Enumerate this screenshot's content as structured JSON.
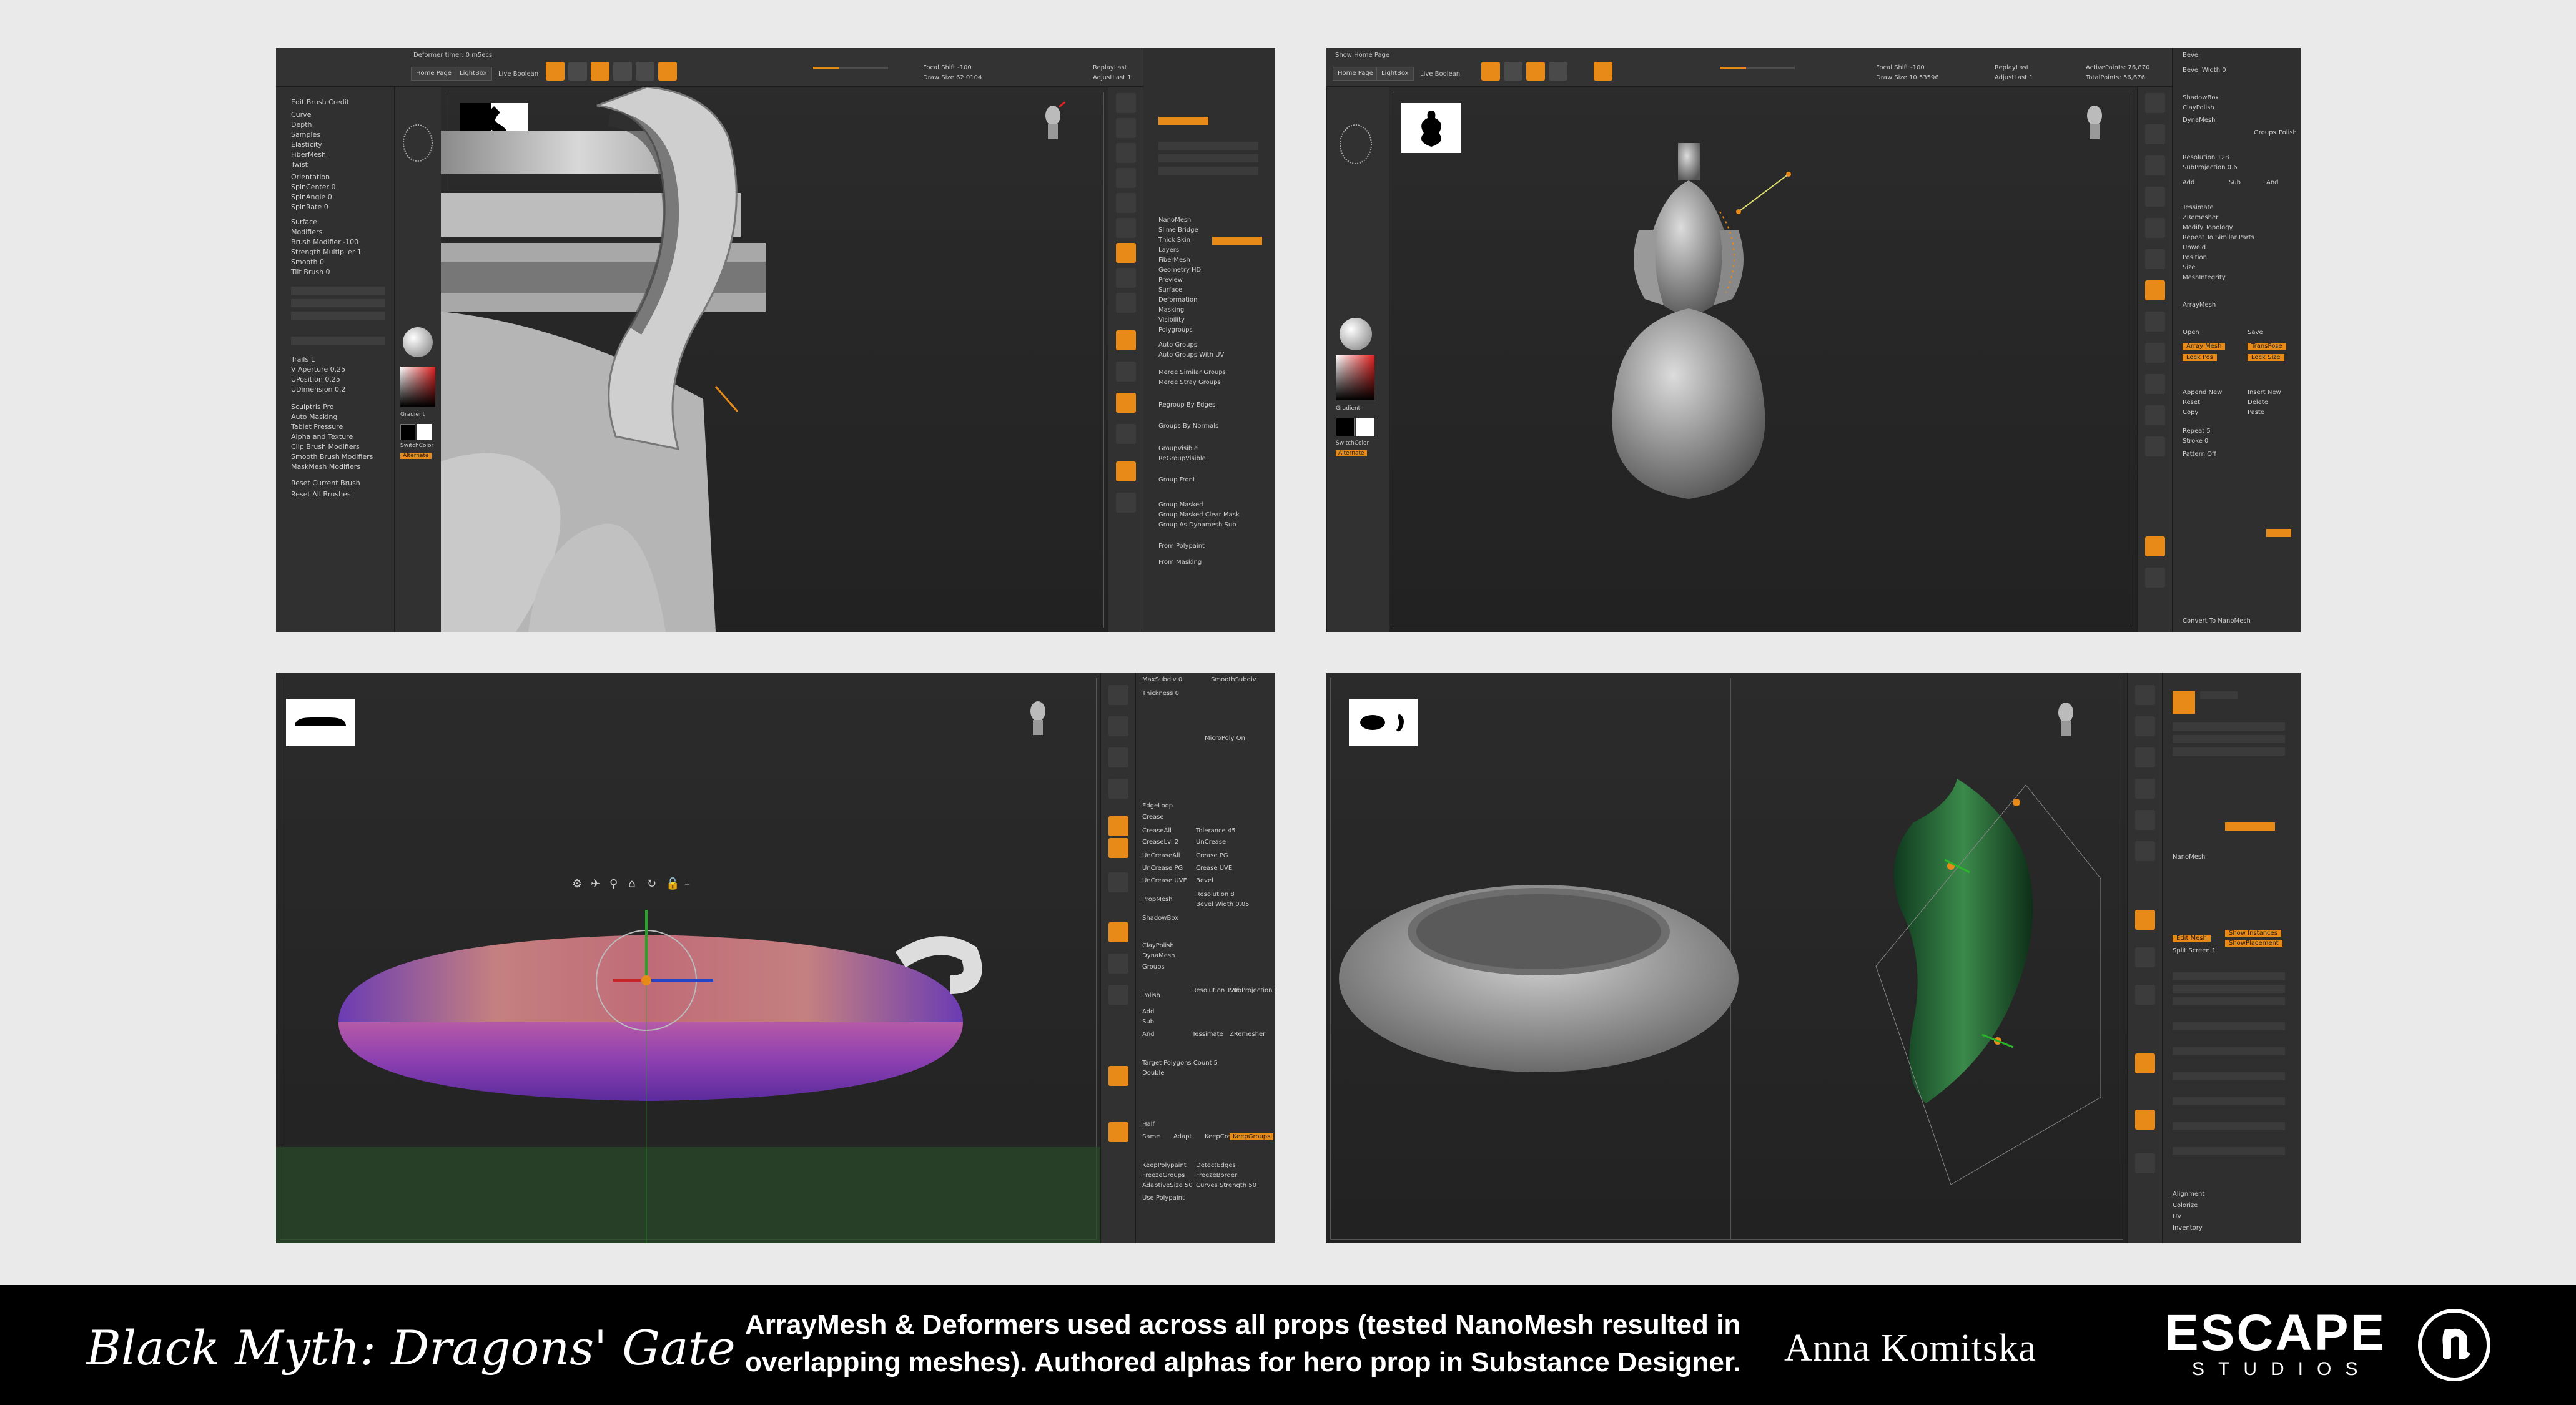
{
  "panels": [
    {
      "header": {
        "status": "Deformer timer: 0 m5ecs",
        "home_tab": "Home Page",
        "lightbox_tab": "LightBox",
        "live_boolean": "Live Boolean",
        "focal": "Focal Shift -100",
        "draw_size": "Draw Size 62.0104",
        "replay": "ReplayLast",
        "adjust": "AdjustLast 1"
      },
      "left_menu": [
        "Edit Brush Credit",
        "Curve",
        "Depth",
        "Samples",
        "Elasticity",
        "FiberMesh",
        "Twist",
        "Orientation",
        "SpinCenter 0",
        "SpinAngle 0",
        "SpinRate 0",
        "Surface",
        "Modifiers",
        "Brush Modifier -100",
        "Strength Multiplier 1",
        "Smooth 0",
        "Tilt Brush 0",
        "Trails 1",
        "V Aperture 0.25",
        "UPosition 0.25",
        "UDimension 0.2",
        "Sculptris Pro",
        "Auto Masking",
        "Tablet Pressure",
        "Alpha and Texture",
        "Clip Brush Modifiers",
        "Smooth Brush Modifiers",
        "MaskMesh Modifiers",
        "Reset Current Brush",
        "Reset All Brushes"
      ],
      "right_menu": [
        "NanoMesh",
        "Slime Bridge",
        "Thick Skin",
        "Layers",
        "FiberMesh",
        "Geometry HD",
        "Preview",
        "Surface",
        "Deformation",
        "Masking",
        "Visibility",
        "Polygroups",
        "Auto Groups",
        "Auto Groups With UV",
        "Merge Similar Groups",
        "Merge Stray Groups",
        "Regroup By Edges",
        "Groups By Normals",
        "GroupVisible",
        "ReGroupVisible",
        "Group Front",
        "Group Masked",
        "Group Masked Clear Mask",
        "Group As Dynamesh Sub",
        "From Polypaint",
        "From Masking"
      ],
      "strip_labels": [
        "Gradient",
        "SwitchColor",
        "Alternate"
      ]
    },
    {
      "header": {
        "status": "Show Home Page",
        "home_tab": "Home Page",
        "lightbox_tab": "LightBox",
        "live_boolean": "Live Boolean",
        "focal": "Focal Shift -100",
        "draw_size": "Draw Size 10.53596",
        "replay": "ReplayLast",
        "adjust": "AdjustLast 1",
        "active_points": "ActivePoints: 76,870",
        "total_points": "TotalPoints: 56,676"
      },
      "right_menu": [
        "Bevel",
        "Bevel Width 0",
        "ShadowBox",
        "ClayPolish",
        "DynaMesh",
        "Groups",
        "Polish",
        "Resolution 128",
        "SubProjection 0.6",
        "Add",
        "Sub",
        "And",
        "Tessimate",
        "ZRemesher",
        "Modify Topology",
        "Repeat To Similar Parts",
        "Unweld",
        "Position",
        "Size",
        "MeshIntegrity",
        "ArrayMesh",
        "Open",
        "Save",
        "Array Mesh",
        "TransPose",
        "Lock Pos",
        "Lock Size",
        "Append New",
        "Insert New",
        "Reset",
        "Delete",
        "Copy",
        "Paste",
        "Repeat 5",
        "Stroke 0",
        "Pattern Off",
        "Convert To NanoMesh"
      ],
      "strip_labels": [
        "Gradient",
        "SwitchColor",
        "Alternate"
      ]
    },
    {
      "header": {},
      "right_menu": [
        "MaxSubdiv 0",
        "SmoothSubdiv",
        "Thickness 0",
        "MicroPoly On",
        "EdgeLoop",
        "Crease",
        "CreaseAll",
        "Tolerance 45",
        "CreaseLvl 2",
        "UnCrease",
        "UnCreaseAll",
        "Crease PG",
        "UnCrease PG",
        "Crease UVE",
        "UnCrease UVE",
        "Bevel",
        "PropMesh",
        "Resolution 8",
        "Bevel Width 0.05",
        "ShadowBox",
        "ClayPolish",
        "DynaMesh",
        "Groups",
        "Polish",
        "Resolution 128",
        "SubProjection 0.6",
        "Add",
        "Sub",
        "And",
        "Tessimate",
        "ZRemesher",
        "Target Polygons Count 5",
        "Double",
        "Half",
        "Same",
        "Adapt",
        "KeepCreases",
        "KeepGroups",
        "KeepPolypaint",
        "DetectEdges",
        "FreezeGroups",
        "FreezeBorder",
        "AdaptiveSize 50",
        "Curves Strength 50",
        "Use Polypaint"
      ],
      "gizmo_ticks": [
        0,
        1,
        2,
        3,
        4,
        5
      ]
    },
    {
      "header": {},
      "right_menu": [
        "NanoMesh",
        "Edit Mesh",
        "Show Instances",
        "Split Screen 1",
        "ShowPlacement",
        "Alignment",
        "Colorize",
        "UV",
        "Inventory"
      ],
      "strip_labels": []
    }
  ],
  "footer": {
    "title": "Black Myth: Dragons' Gate",
    "caption_line1": "ArrayMesh & Deformers used across all props (tested NanoMesh resulted in",
    "caption_line2": "overlapping meshes). Authored alphas for hero prop in Substance Designer.",
    "author": "Anna Komitska",
    "brand": "ESCAPE",
    "brand_sub": "STUDIOS"
  },
  "colors": {
    "accent": "#e88a17",
    "ui_bg": "#2a2a2a",
    "footer_bg": "#000000"
  }
}
